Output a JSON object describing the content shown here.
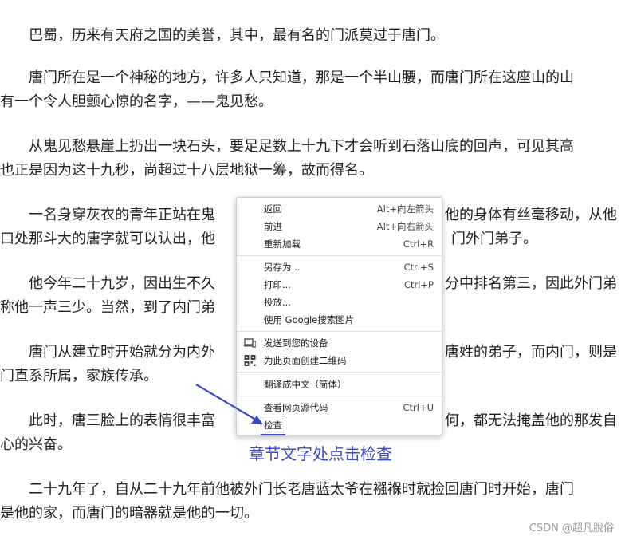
{
  "article": {
    "paragraphs": [
      {
        "lines": [
          "巴蜀，历来有天府之国的美誉，其中，最有名的门派莫过于唐门。"
        ]
      },
      {
        "lines": [
          "唐门所在是一个神秘的地方，许多人只知道，那是一个半山腰，而唐门所在这座山的山",
          "有一个令人胆颤心惊的名字，——鬼见愁。"
        ]
      },
      {
        "lines": [
          "从鬼见愁悬崖上扔出一块石头，要足足数上十九下才会听到石落山底的回声，可见其高",
          "也正是因为这十九秒，尚超过十八层地狱一筹，故而得名。"
        ]
      },
      {
        "lines": [
          "一名身穿灰衣的青年正站在鬼",
          "口处那斗大的唐字就可以认出，他"
        ],
        "right": [
          "他的身体有丝毫移动，从他",
          "门外门弟子。"
        ]
      },
      {
        "lines": [
          "他今年二十九岁，因出生不久",
          "称他一声三少。当然，到了内门弟"
        ],
        "right": [
          "分中排名第三，因此外门弟",
          ""
        ]
      },
      {
        "lines": [
          "唐门从建立时开始就分为内外",
          "门直系所属，家族传承。"
        ],
        "right": [
          "唐姓的弟子，而内门，则是",
          ""
        ]
      },
      {
        "lines": [
          "此时，唐三脸上的表情很丰富",
          "心的兴奋。"
        ],
        "right": [
          "何，都无法掩盖他的那发自",
          ""
        ]
      },
      {
        "lines": [
          "二十九年了，自从二十九年前他被外门长老唐蓝太爷在襁褓时就捡回唐门时开始，唐门",
          "是他的家，而唐门的暗器就是他的一切。"
        ]
      }
    ]
  },
  "context_menu": {
    "items": [
      {
        "label": "返回",
        "shortcut": "Alt+向左箭头",
        "icon": ""
      },
      {
        "label": "前进",
        "shortcut": "Alt+向右箭头",
        "icon": ""
      },
      {
        "label": "重新加载",
        "shortcut": "Ctrl+R",
        "icon": ""
      },
      {
        "label": "另存为...",
        "shortcut": "Ctrl+S",
        "icon": ""
      },
      {
        "label": "打印...",
        "shortcut": "Ctrl+P",
        "icon": ""
      },
      {
        "label": "投放...",
        "shortcut": "",
        "icon": ""
      },
      {
        "label": "使用 Google搜索图片",
        "shortcut": "",
        "icon": ""
      },
      {
        "label": "发送到您的设备",
        "shortcut": "",
        "icon": "device-send-icon"
      },
      {
        "label": "为此页面创建二维码",
        "shortcut": "",
        "icon": "qr-code-icon"
      },
      {
        "label": "翻译成中文（简体）",
        "shortcut": "",
        "icon": ""
      },
      {
        "label": "查看网页源代码",
        "shortcut": "Ctrl+U",
        "icon": ""
      },
      {
        "label": "检查",
        "shortcut": "",
        "icon": ""
      }
    ]
  },
  "annotation": {
    "text": "章节文字处点击检查",
    "color": "#3a49c7"
  },
  "watermark": {
    "text": "CSDN @超凡脫俗"
  }
}
